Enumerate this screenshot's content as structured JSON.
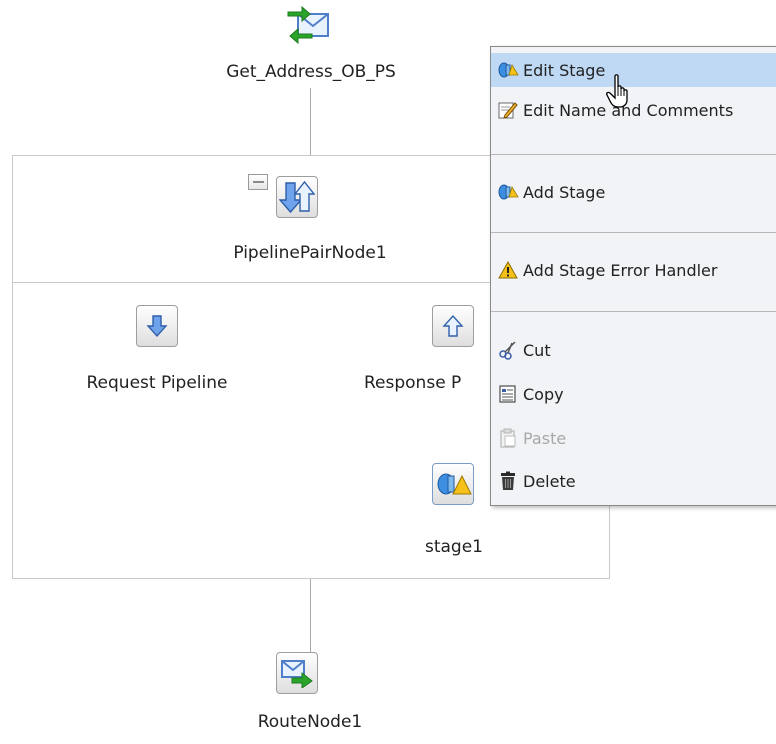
{
  "nodes": {
    "proxy": {
      "label": "Get_Address_OB_PS",
      "icon": "envelope-arrows-icon"
    },
    "pipeline_pair": {
      "label": "PipelinePairNode1",
      "icon": "up-down-arrows-icon",
      "collapse": "−"
    },
    "request": {
      "label": "Request Pipeline",
      "icon": "down-arrow-icon"
    },
    "response": {
      "label": "Response P",
      "icon": "up-arrow-icon"
    },
    "stage": {
      "label": "stage1",
      "icon": "stage-warning-icon"
    },
    "route": {
      "label": "RouteNode1",
      "icon": "envelope-route-icon"
    }
  },
  "context_menu": {
    "items": [
      {
        "label": "Edit Stage",
        "icon": "stage-icon",
        "highlighted": true,
        "enabled": true
      },
      {
        "label": "Edit Name and Comments",
        "icon": "edit-pencil-icon",
        "enabled": true
      },
      {
        "label": "Add Stage",
        "icon": "stage-icon",
        "enabled": true
      },
      {
        "label": "Add Stage Error Handler",
        "icon": "warning-icon",
        "enabled": true
      },
      {
        "label": "Cut",
        "icon": "scissors-icon",
        "enabled": true
      },
      {
        "label": "Copy",
        "icon": "copy-icon",
        "enabled": true
      },
      {
        "label": "Paste",
        "icon": "paste-icon",
        "enabled": false
      },
      {
        "label": "Delete",
        "icon": "trash-icon",
        "enabled": true
      }
    ]
  },
  "colors": {
    "menu_highlight": "#bfd8f4",
    "menu_background": "#f1f3f6",
    "arrow_blue": "#2f6fd4",
    "arrow_green": "#2aa52a"
  }
}
